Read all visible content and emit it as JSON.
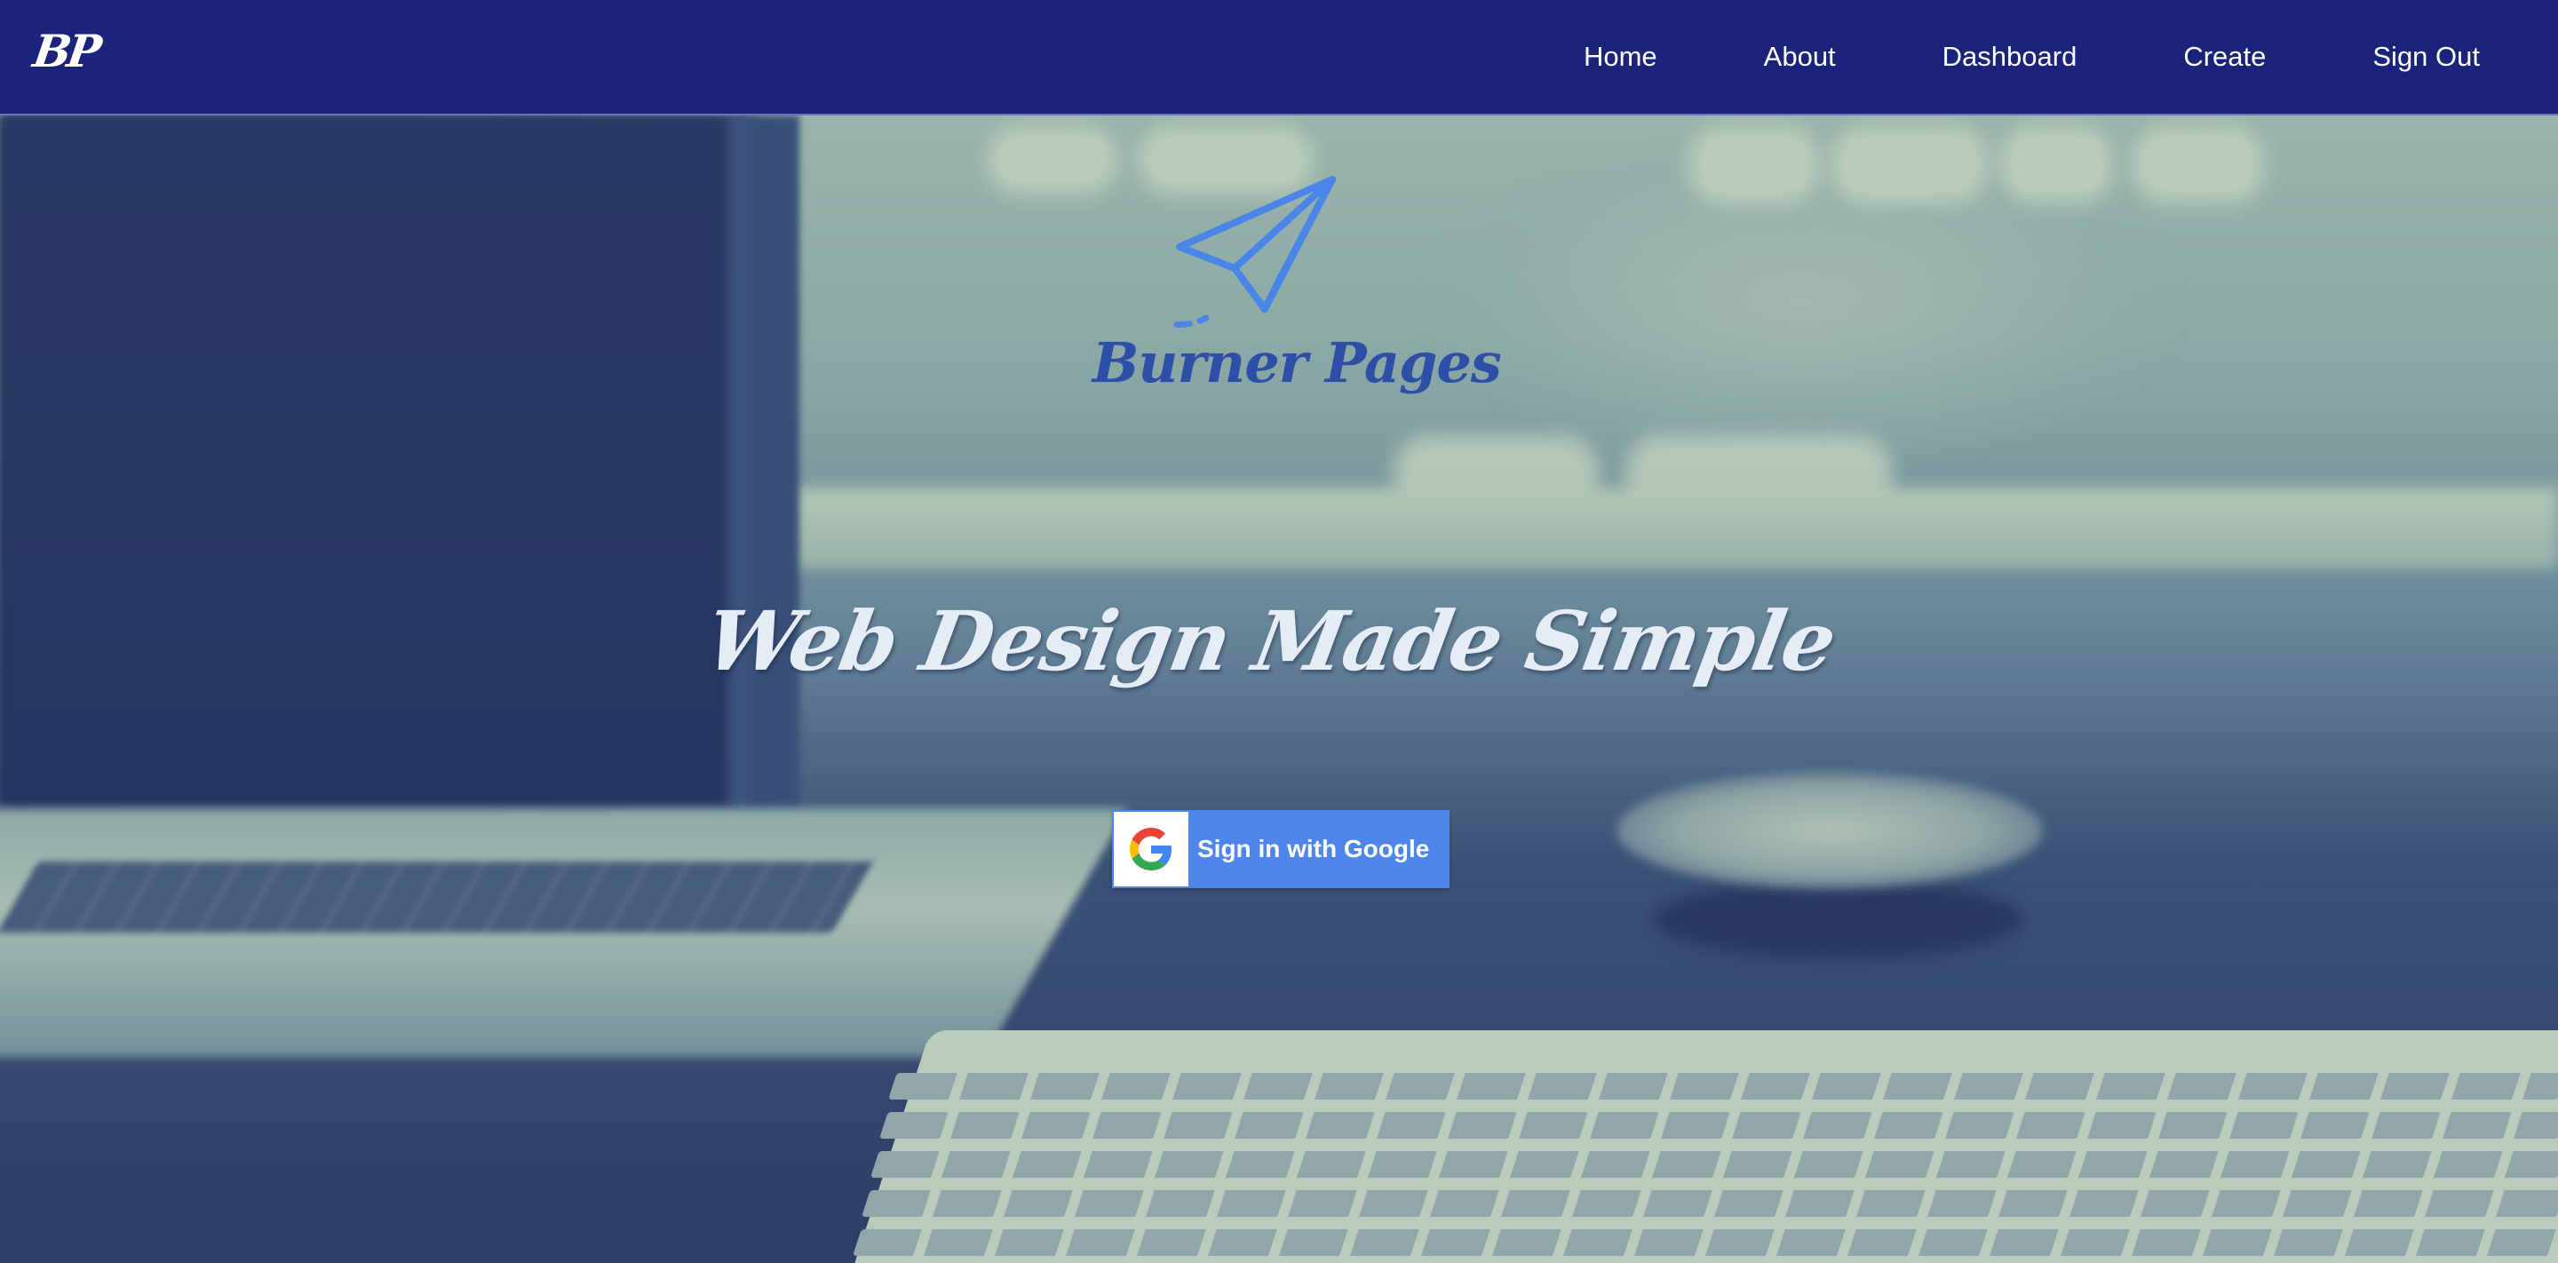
{
  "navbar": {
    "brand": "BP",
    "links": [
      {
        "label": "Home"
      },
      {
        "label": "About"
      },
      {
        "label": "Dashboard"
      },
      {
        "label": "Create"
      },
      {
        "label": "Sign Out"
      }
    ]
  },
  "hero": {
    "logo_text": "Burner Pages",
    "logo_icon": "paper-plane-icon",
    "headline": "Web Design Made Simple",
    "google_button": {
      "label": "Sign in with Google",
      "icon": "google-icon"
    }
  },
  "colors": {
    "navbar_bg": "#1b237b",
    "logo_blue": "#2d4fa8",
    "plane_blue": "#4a86e8",
    "google_button_bg": "#4f86ec",
    "headline_text": "#e6ecf5"
  }
}
